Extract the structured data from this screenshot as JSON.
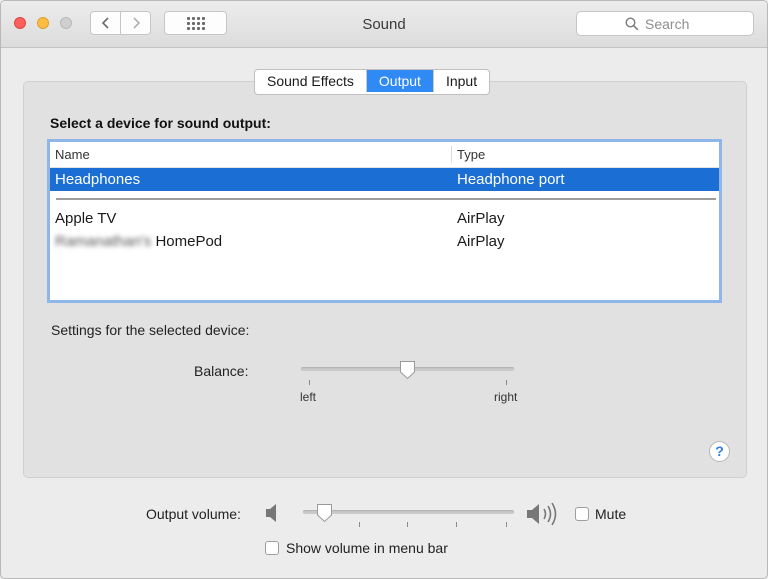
{
  "window": {
    "title": "Sound"
  },
  "toolbar": {
    "back_icon": "chevron-left-icon",
    "forward_icon": "chevron-right-icon",
    "show_all_icon": "grid-icon",
    "search_placeholder": "Search"
  },
  "tabs": [
    {
      "label": "Sound Effects",
      "active": false
    },
    {
      "label": "Output",
      "active": true
    },
    {
      "label": "Input",
      "active": false
    }
  ],
  "output": {
    "section_title": "Select a device for sound output:",
    "columns": {
      "name": "Name",
      "type": "Type"
    },
    "devices": [
      {
        "name": "Headphones",
        "type": "Headphone port",
        "selected": true
      },
      {
        "name": "Apple TV",
        "type": "AirPlay",
        "selected": false
      },
      {
        "name_blurred": "Ramanathan's",
        "name": "HomePod",
        "type": "AirPlay",
        "selected": false
      }
    ],
    "settings_label": "Settings for the selected device:",
    "balance": {
      "label": "Balance:",
      "left_label": "left",
      "right_label": "right",
      "value": 0.5
    }
  },
  "help": {
    "label": "?"
  },
  "volume": {
    "label": "Output volume:",
    "value": 0.1,
    "mute_label": "Mute",
    "mute_checked": false,
    "show_in_menu_bar_label": "Show volume in menu bar",
    "show_in_menu_bar_checked": false
  },
  "colors": {
    "accent": "#2f8af5",
    "selection": "#1b6ed3",
    "focus_ring": "#8fb6e8"
  }
}
